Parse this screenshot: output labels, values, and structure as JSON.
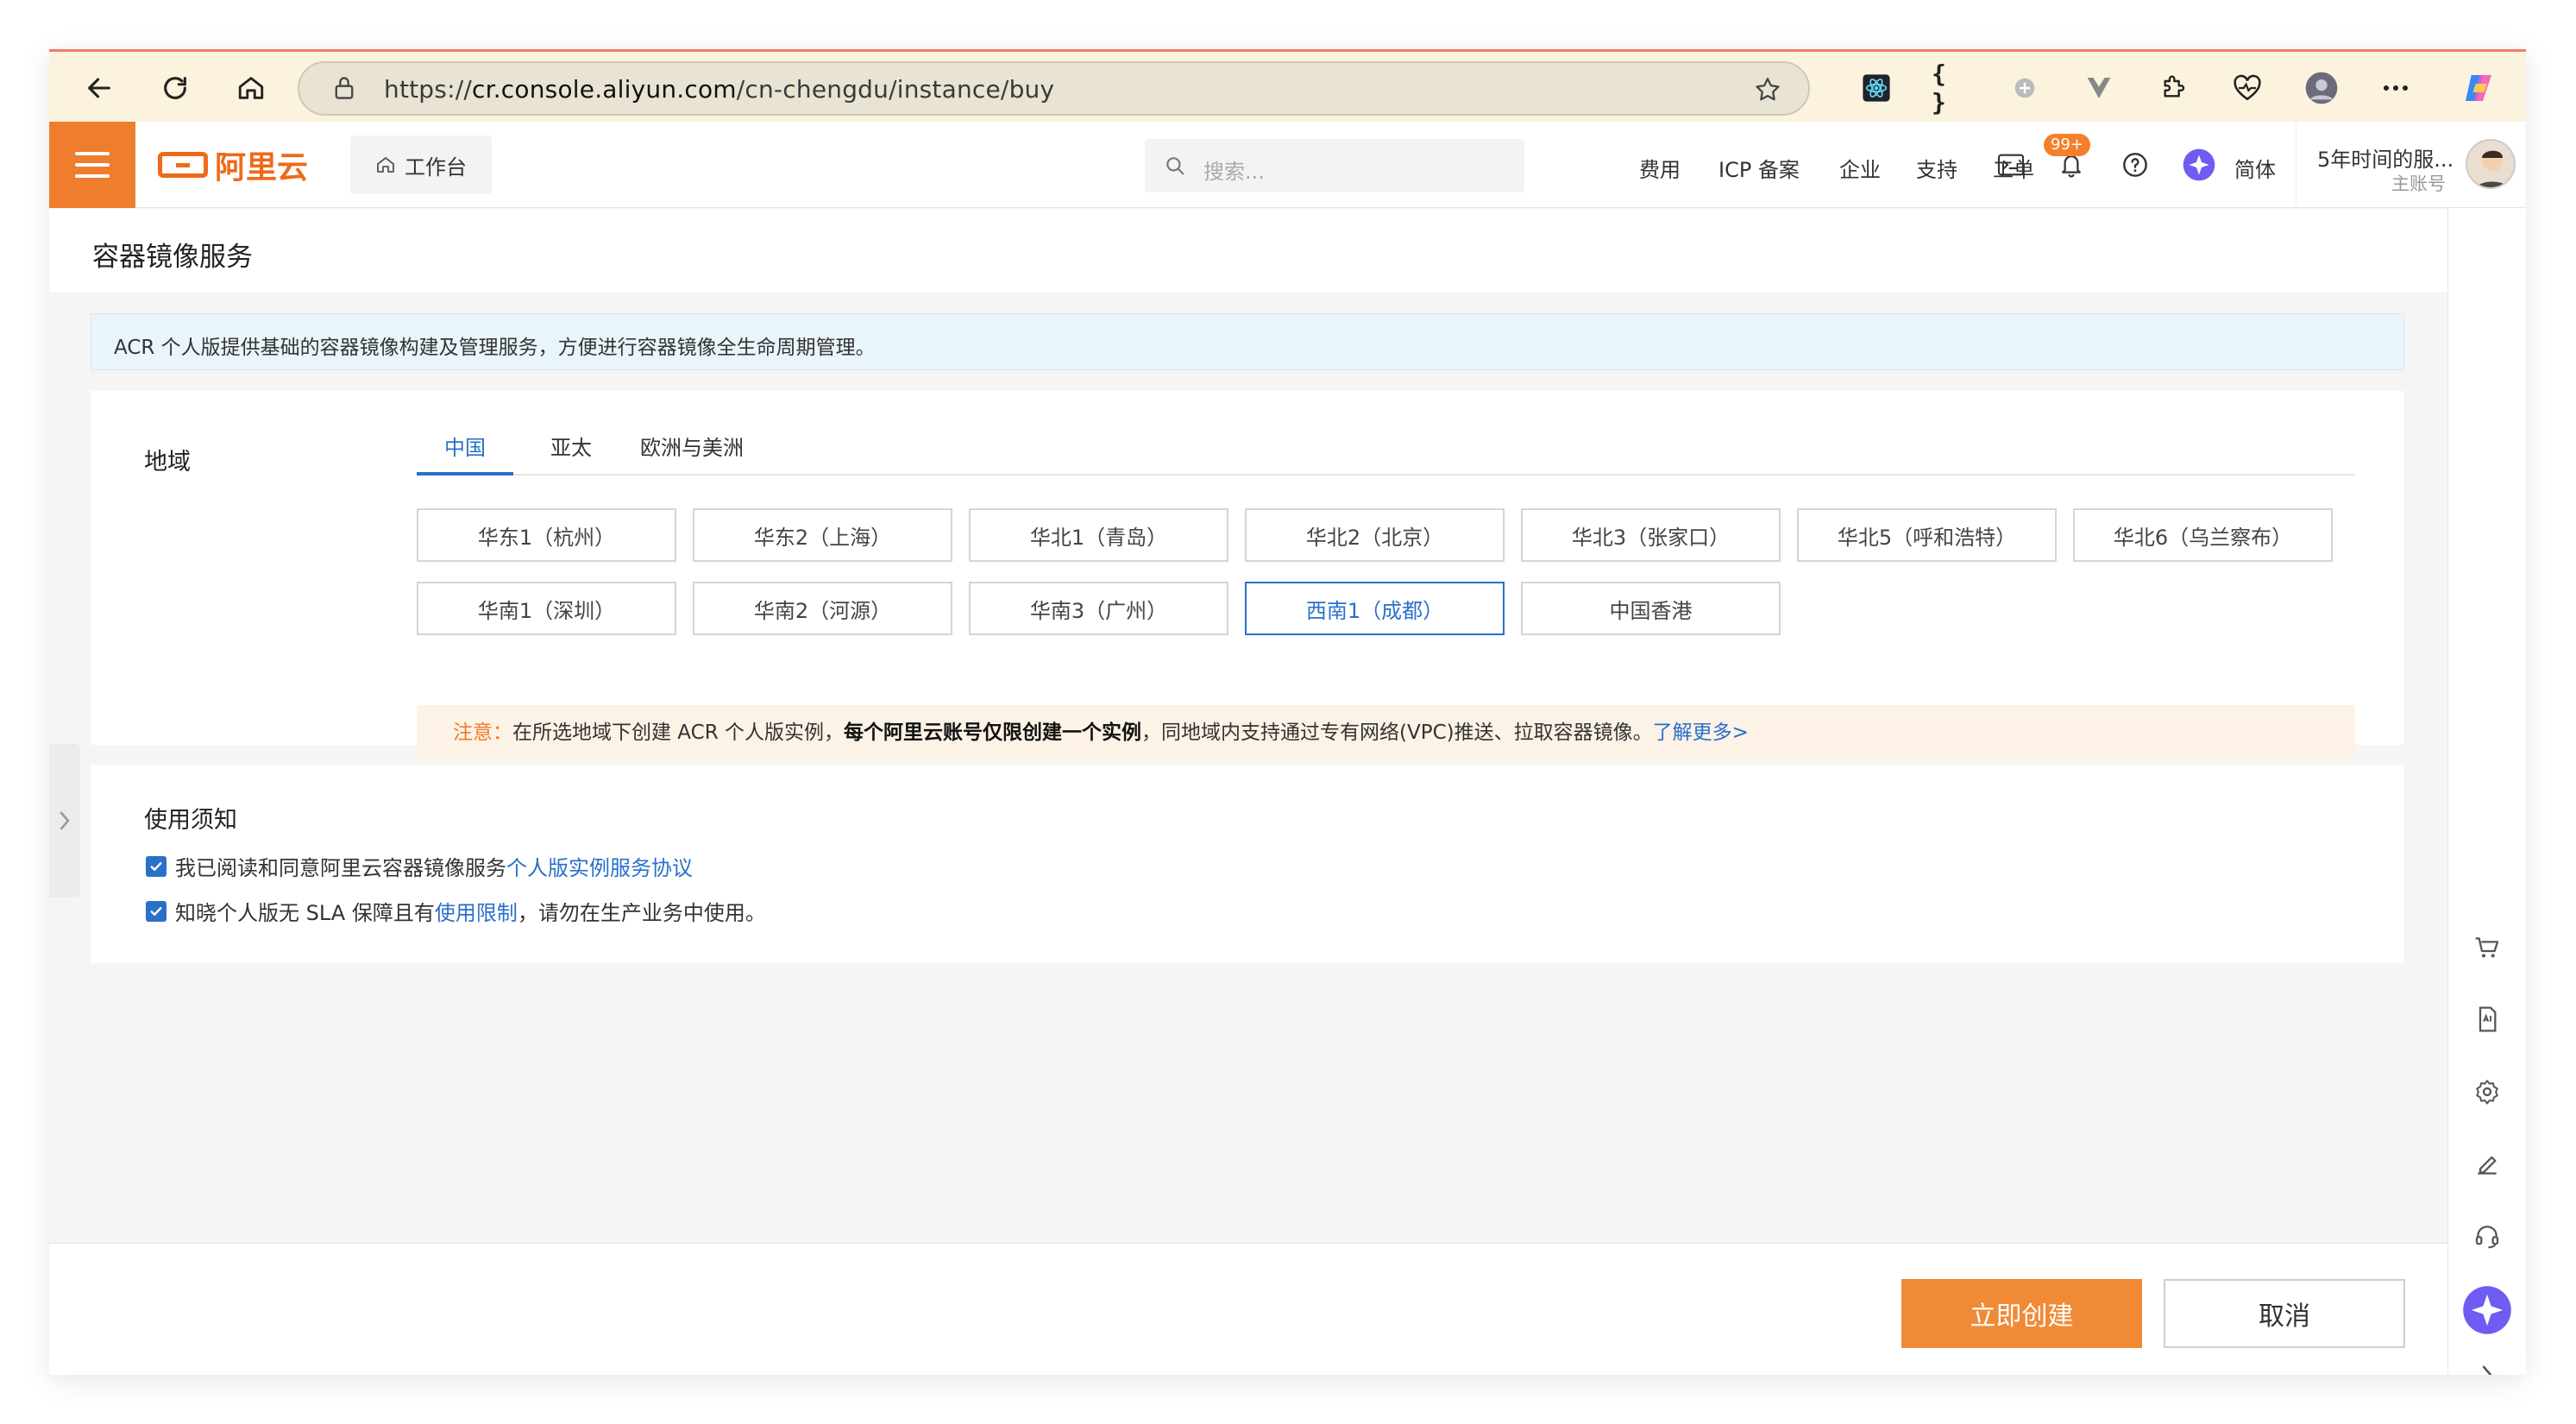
{
  "browser": {
    "url_prefix": "https://",
    "url_host": "cr.console.aliyun.com",
    "url_path": "/cn-chengdu/instance/buy",
    "ext_json": "{ }"
  },
  "header": {
    "logo_text": "阿里云",
    "workbench": "工作台",
    "search_placeholder": "搜索...",
    "nav": [
      "费用",
      "ICP 备案",
      "企业",
      "支持",
      "工单"
    ],
    "notification_badge": "99+",
    "language": "简体",
    "account_name": "5年时间的服...",
    "account_role": "主账号"
  },
  "page": {
    "title": "容器镜像服务",
    "notice": "ACR 个人版提供基础的容器镜像构建及管理服务，方便进行容器镜像全生命周期管理。"
  },
  "region": {
    "label": "地域",
    "tabs": [
      "中国",
      "亚太",
      "欧洲与美洲"
    ],
    "active_tab": "中国",
    "options": [
      "华东1（杭州）",
      "华东2（上海）",
      "华北1（青岛）",
      "华北2（北京）",
      "华北3（张家口）",
      "华北5（呼和浩特）",
      "华北6（乌兰察布）",
      "华南1（深圳）",
      "华南2（河源）",
      "华南3（广州）",
      "西南1（成都）",
      "中国香港"
    ],
    "selected": "西南1（成都）",
    "warning_label": "注意：",
    "warning_text1": "在所选地域下创建 ACR 个人版实例，",
    "warning_bold": "每个阿里云账号仅限创建一个实例",
    "warning_text2": "，同地域内支持通过专有网络(VPC)推送、拉取容器镜像。",
    "warning_link": "了解更多>"
  },
  "terms": {
    "title": "使用须知",
    "item1_text": "我已阅读和同意阿里云容器镜像服务",
    "item1_link": "个人版实例服务协议",
    "item1_checked": true,
    "item2_text1": "知晓个人版无 SLA 保障且有",
    "item2_link": "使用限制",
    "item2_text2": "，请勿在生产业务中使用。",
    "item2_checked": true
  },
  "footer": {
    "create": "立即创建",
    "cancel": "取消"
  },
  "colors": {
    "brand": "#ee7e2d",
    "link": "#2a70c9",
    "primary_button": "#f08a36"
  }
}
